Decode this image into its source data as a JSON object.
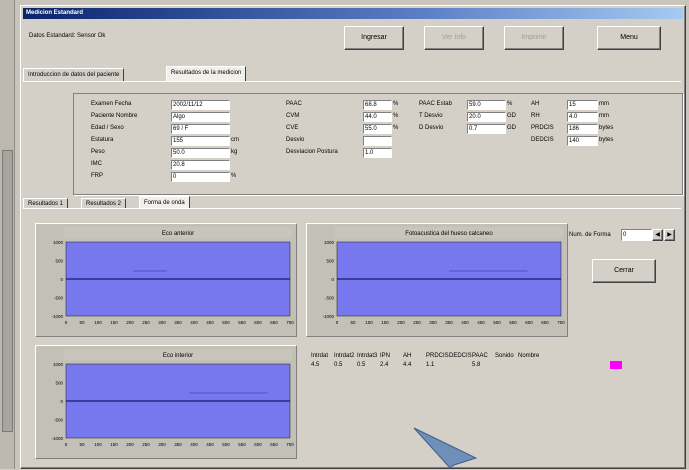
{
  "window": {
    "title": "Medicion Estandard"
  },
  "header": {
    "status_text": "Datos Estandard: Sensor Ok",
    "buttons": {
      "ingresar": "Ingresar",
      "ver": "Ver Info",
      "imprimir": "Imprimir",
      "menu": "Menu"
    }
  },
  "main_tabs": [
    {
      "label": "Introduccion de datos del paciente"
    },
    {
      "label": "Resultados de la medicion"
    }
  ],
  "patient": {
    "rows": [
      {
        "label": "Examen Fecha",
        "value": "2002/11/12",
        "unit": ""
      },
      {
        "label": "Paciente Nombre",
        "value": "Algo",
        "unit": ""
      },
      {
        "label": "Edad / Sexo",
        "value": "69 / F",
        "unit": ""
      },
      {
        "label": "Estatura",
        "value": "155",
        "unit": "cm"
      },
      {
        "label": "Peso",
        "value": "50.0",
        "unit": "kg"
      },
      {
        "label": "IMC",
        "value": "20.8",
        "unit": ""
      },
      {
        "label": "FRP",
        "value": "0",
        "unit": "%"
      }
    ]
  },
  "results_mid": {
    "rows": [
      {
        "label": "PAAC",
        "value": "68.8",
        "unit": "%"
      },
      {
        "label": "CVM",
        "value": "44.0",
        "unit": "%"
      },
      {
        "label": "CVE",
        "value": "55.0",
        "unit": "%"
      },
      {
        "label": "Desvio",
        "value": "",
        "unit": ""
      },
      {
        "label": "Desviacion Postura",
        "value": "1.0",
        "unit": ""
      }
    ]
  },
  "results_right1": {
    "rows": [
      {
        "label": "PAAC Estab",
        "value": "59.0",
        "unit": "%"
      },
      {
        "label": "T Desvio",
        "value": "20.0",
        "unit": "GD"
      },
      {
        "label": "D Desvio",
        "value": "0.7",
        "unit": "GD"
      }
    ]
  },
  "results_right2": {
    "rows": [
      {
        "label": "AH",
        "value": "15",
        "unit": "mm"
      },
      {
        "label": "RH",
        "value": "4.0",
        "unit": "mm"
      },
      {
        "label": "PRDCIS",
        "value": "186",
        "unit": "bytes"
      },
      {
        "label": "DEDCIS",
        "value": "140",
        "unit": "bytes"
      }
    ]
  },
  "sub_tabs": [
    {
      "label": "Resultados 1"
    },
    {
      "label": "Resultados 2"
    },
    {
      "label": "Forma de onda"
    }
  ],
  "charts": [
    {
      "title": "Eco anterior",
      "yticks": [
        "1000",
        "500",
        "0",
        "-500",
        "-1000"
      ],
      "xticks": [
        "0",
        "50",
        "100",
        "150",
        "200",
        "250",
        "300",
        "350",
        "400",
        "450",
        "500",
        "550",
        "600",
        "650",
        "700"
      ],
      "signal": [
        0.9,
        0.0,
        0.3,
        0.45,
        0.9
      ]
    },
    {
      "title": "Fotoacustica del hueso calcaneo",
      "yticks": [
        "1000",
        "500",
        "0",
        "-500",
        "-1000"
      ],
      "xticks": [
        "0",
        "50",
        "100",
        "150",
        "200",
        "250",
        "300",
        "350",
        "400",
        "450",
        "500",
        "550",
        "600",
        "650",
        "700"
      ],
      "signal": [
        0.9,
        0.0,
        0.5,
        0.85,
        0.9
      ]
    },
    {
      "title": "Eco interior",
      "yticks": [
        "1000",
        "500",
        "0",
        "-500",
        "-1000"
      ],
      "xticks": [
        "0",
        "50",
        "100",
        "150",
        "200",
        "250",
        "300",
        "350",
        "400",
        "450",
        "500",
        "550",
        "600",
        "650",
        "700"
      ],
      "signal": [
        0.9,
        0.0,
        0.55,
        0.9,
        0.9
      ]
    }
  ],
  "controls": {
    "forma_label": "Num. de Forma",
    "forma_value": "0",
    "cerrar_label": "Cerrar"
  },
  "bottom_table": {
    "headers": [
      "Intrdat",
      "Intrdat2",
      "Intrdat3",
      "IPN",
      "AH",
      "PRDCIS",
      "DEDCIS",
      "PAAC",
      "Sonido",
      "Nombre"
    ],
    "values": [
      "4.5",
      "0.5",
      "0.5",
      "2.4",
      "4.4",
      "1.1",
      "",
      "5.8",
      "",
      ""
    ]
  },
  "colors": {
    "chart_bg": "#7777ee",
    "signal": "#5050cc",
    "highlight": "#ff00ff"
  }
}
